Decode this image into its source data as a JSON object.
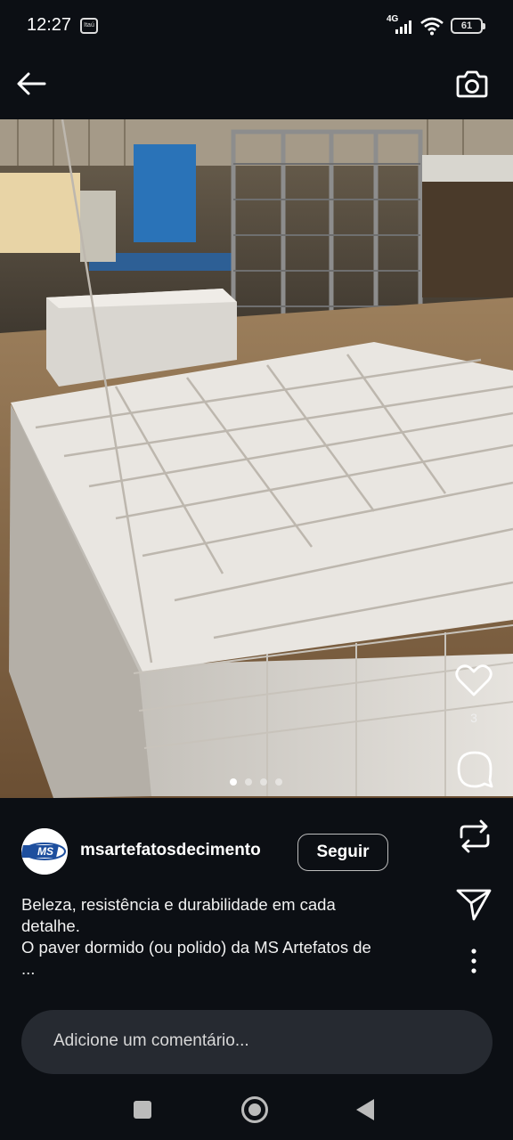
{
  "status_bar": {
    "time": "12:27",
    "carrier": "Itaú",
    "network": "4G",
    "battery": "61"
  },
  "post": {
    "username": "msartefatosdecimento",
    "avatar_text": "MS",
    "follow_label": "Seguir",
    "like_count": "3",
    "caption_lines": [
      "Beleza, resistência e durabilidade em cada",
      "detalhe.",
      "O paver dormido (ou polido) da MS Artefatos de",
      "..."
    ],
    "carousel_total": 4,
    "carousel_active": 1
  },
  "comment": {
    "placeholder": "Adicione um comentário..."
  },
  "icons": {
    "back": "back-arrow-icon",
    "camera": "camera-icon",
    "like": "heart-icon",
    "comment": "comment-bubble-icon",
    "repost": "repost-icon",
    "share": "send-icon",
    "more": "more-vertical-icon"
  },
  "colors": {
    "background": "#0c0f14",
    "comment_box": "#262a31",
    "text": "#f2f2f2"
  }
}
